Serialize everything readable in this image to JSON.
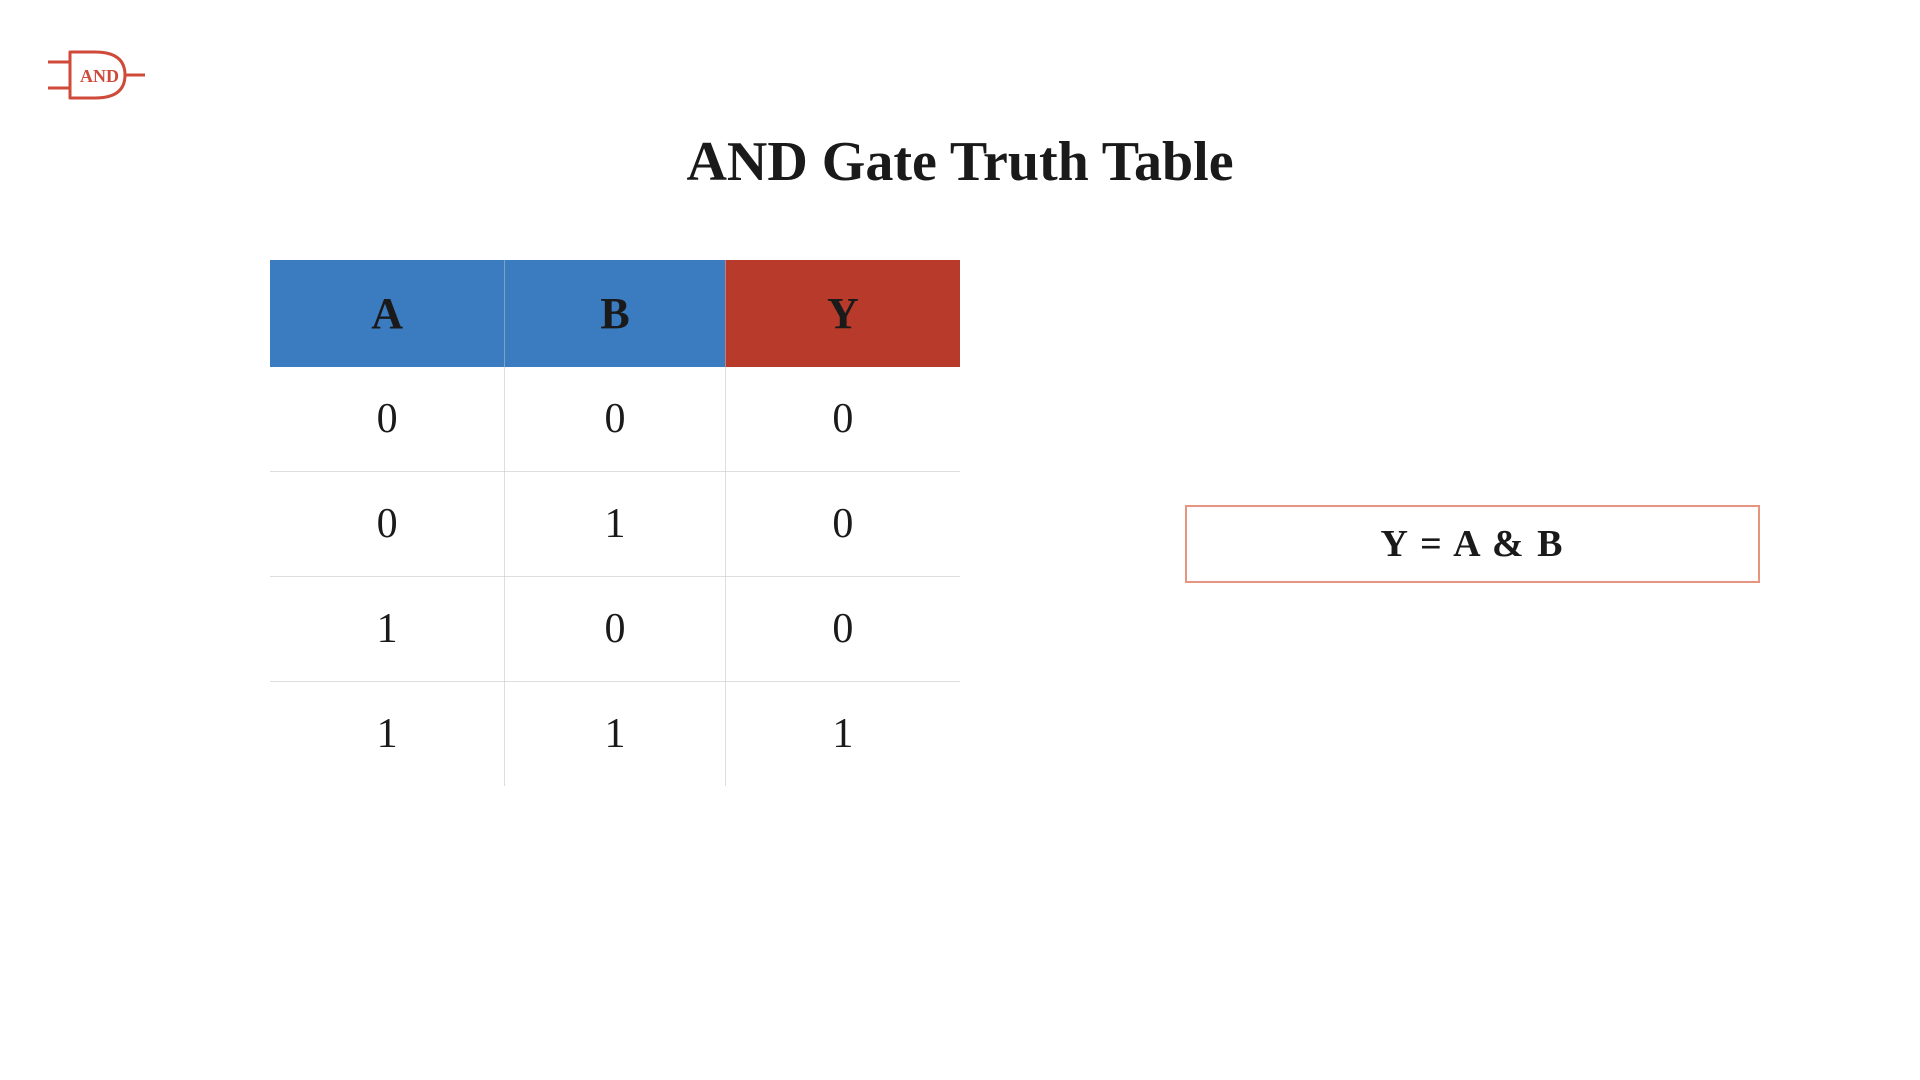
{
  "title": "AND Gate Truth Table",
  "gate_label": "AND",
  "equation": "Y = A & B",
  "table": {
    "headers": [
      "A",
      "B",
      "Y"
    ],
    "rows": [
      [
        "0",
        "0",
        "0"
      ],
      [
        "0",
        "1",
        "0"
      ],
      [
        "1",
        "0",
        "0"
      ],
      [
        "1",
        "1",
        "1"
      ]
    ]
  },
  "chart_data": {
    "type": "table",
    "title": "AND Gate Truth Table",
    "columns": [
      "A",
      "B",
      "Y"
    ],
    "rows": [
      {
        "A": 0,
        "B": 0,
        "Y": 0
      },
      {
        "A": 0,
        "B": 1,
        "Y": 0
      },
      {
        "A": 1,
        "B": 0,
        "Y": 0
      },
      {
        "A": 1,
        "B": 1,
        "Y": 1
      }
    ],
    "equation": "Y = A & B"
  }
}
